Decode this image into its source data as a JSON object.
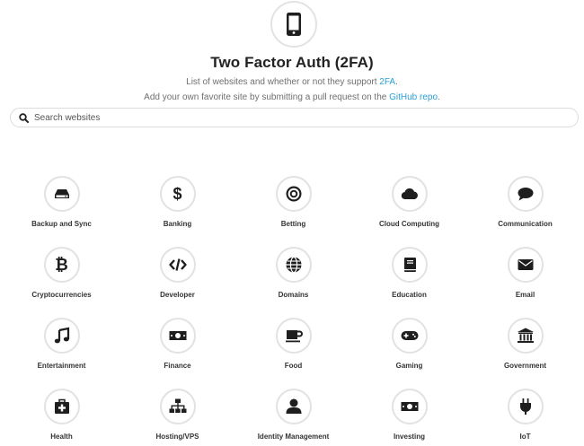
{
  "header": {
    "logo_icon": "mobile-phone-icon",
    "title": "Two Factor Auth (2FA)",
    "line1_text": "List of websites and whether or not they support ",
    "line1_link": "2FA",
    "line1_end": ".",
    "line2_text": "Add your own favorite site by submitting a pull request on the ",
    "line2_link": "GitHub repo",
    "line2_end": "."
  },
  "search": {
    "icon": "search-icon",
    "placeholder": "Search websites",
    "value": ""
  },
  "categories": [
    {
      "label": "Backup and Sync",
      "icon": "hard-drive-icon"
    },
    {
      "label": "Banking",
      "icon": "dollar-icon"
    },
    {
      "label": "Betting",
      "icon": "target-icon"
    },
    {
      "label": "Cloud Computing",
      "icon": "cloud-icon"
    },
    {
      "label": "Communication",
      "icon": "chat-bubble-icon"
    },
    {
      "label": "Cryptocurrencies",
      "icon": "bitcoin-icon"
    },
    {
      "label": "Developer",
      "icon": "code-icon"
    },
    {
      "label": "Domains",
      "icon": "globe-icon"
    },
    {
      "label": "Education",
      "icon": "book-icon"
    },
    {
      "label": "Email",
      "icon": "envelope-icon"
    },
    {
      "label": "Entertainment",
      "icon": "music-note-icon"
    },
    {
      "label": "Finance",
      "icon": "banknote-icon"
    },
    {
      "label": "Food",
      "icon": "coffee-cup-icon"
    },
    {
      "label": "Gaming",
      "icon": "gamepad-icon"
    },
    {
      "label": "Government",
      "icon": "bank-building-icon"
    },
    {
      "label": "Health",
      "icon": "medkit-icon"
    },
    {
      "label": "Hosting/VPS",
      "icon": "sitemap-icon"
    },
    {
      "label": "Identity Management",
      "icon": "user-icon"
    },
    {
      "label": "Investing",
      "icon": "money-icon"
    },
    {
      "label": "IoT",
      "icon": "plug-icon"
    }
  ],
  "colors": {
    "link": "#2a9fd6",
    "icon": "#1e1e1e",
    "circle_border": "#e2e2e2"
  }
}
